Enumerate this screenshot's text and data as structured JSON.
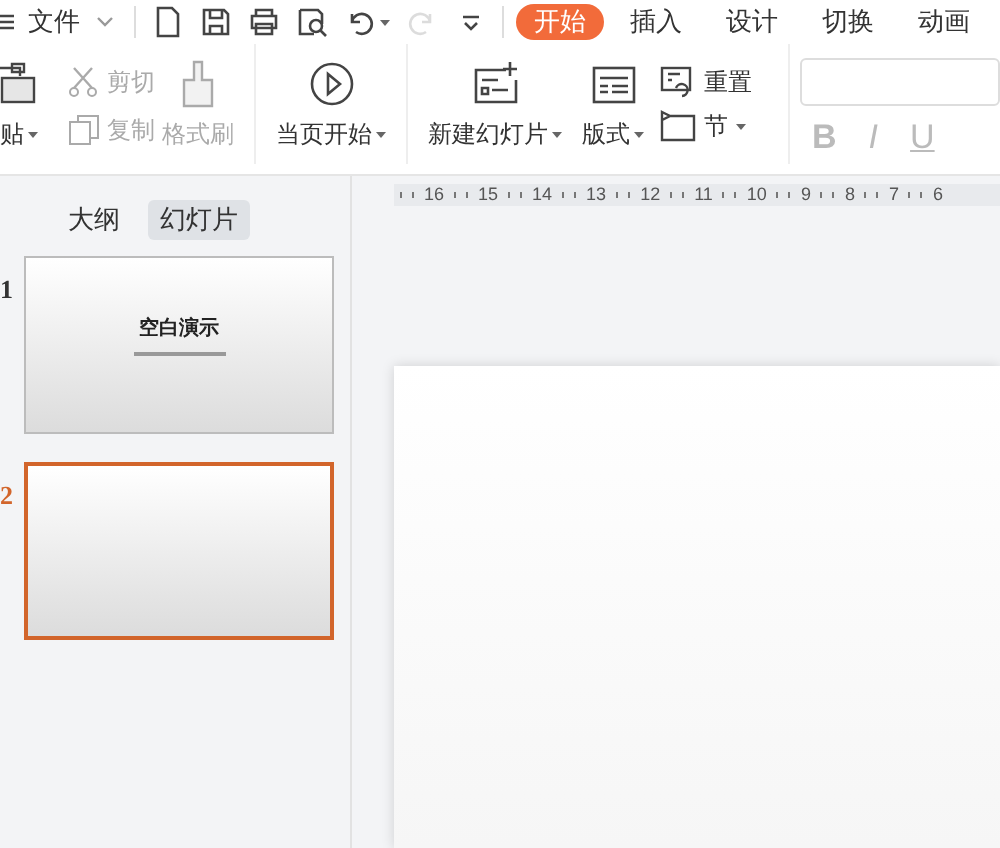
{
  "menu": {
    "file_label": "文件"
  },
  "quick_access": [
    {
      "kind": "new"
    },
    {
      "kind": "save"
    },
    {
      "kind": "print"
    },
    {
      "kind": "preview"
    },
    {
      "kind": "undo"
    },
    {
      "kind": "redo",
      "disabled": true
    },
    {
      "kind": "more"
    }
  ],
  "tabs": [
    {
      "label": "开始",
      "selected": true
    },
    {
      "label": "插入",
      "selected": false
    },
    {
      "label": "设计",
      "selected": false
    },
    {
      "label": "切换",
      "selected": false
    },
    {
      "label": "动画",
      "selected": false
    }
  ],
  "ribbon": {
    "paste": {
      "label": "贴"
    },
    "clipboard": [
      {
        "kind": "cut",
        "label": "剪切",
        "disabled": true
      },
      {
        "kind": "copy",
        "label": "复制",
        "disabled": true
      }
    ],
    "format_painter": {
      "label": "格式刷",
      "disabled": true
    },
    "play": {
      "label": "当页开始"
    },
    "new_slide": {
      "label": "新建幻灯片"
    },
    "layout": {
      "label": "版式"
    },
    "reset": {
      "label": "重置"
    },
    "section": {
      "label": "节"
    },
    "font_styles": [
      {
        "label": "B",
        "disabled": true
      },
      {
        "label": "I",
        "disabled": true
      },
      {
        "label": "U",
        "disabled": true
      }
    ]
  },
  "panel_tabs": [
    {
      "label": "大纲",
      "selected": false
    },
    {
      "label": "幻灯片",
      "selected": true
    }
  ],
  "slides": [
    {
      "number": "1",
      "selected": false,
      "title": "空白演示"
    },
    {
      "number": "2",
      "selected": true
    }
  ],
  "ruler": [
    "16",
    "15",
    "14",
    "13",
    "12",
    "11",
    "10",
    "9",
    "8",
    "7",
    "6"
  ]
}
